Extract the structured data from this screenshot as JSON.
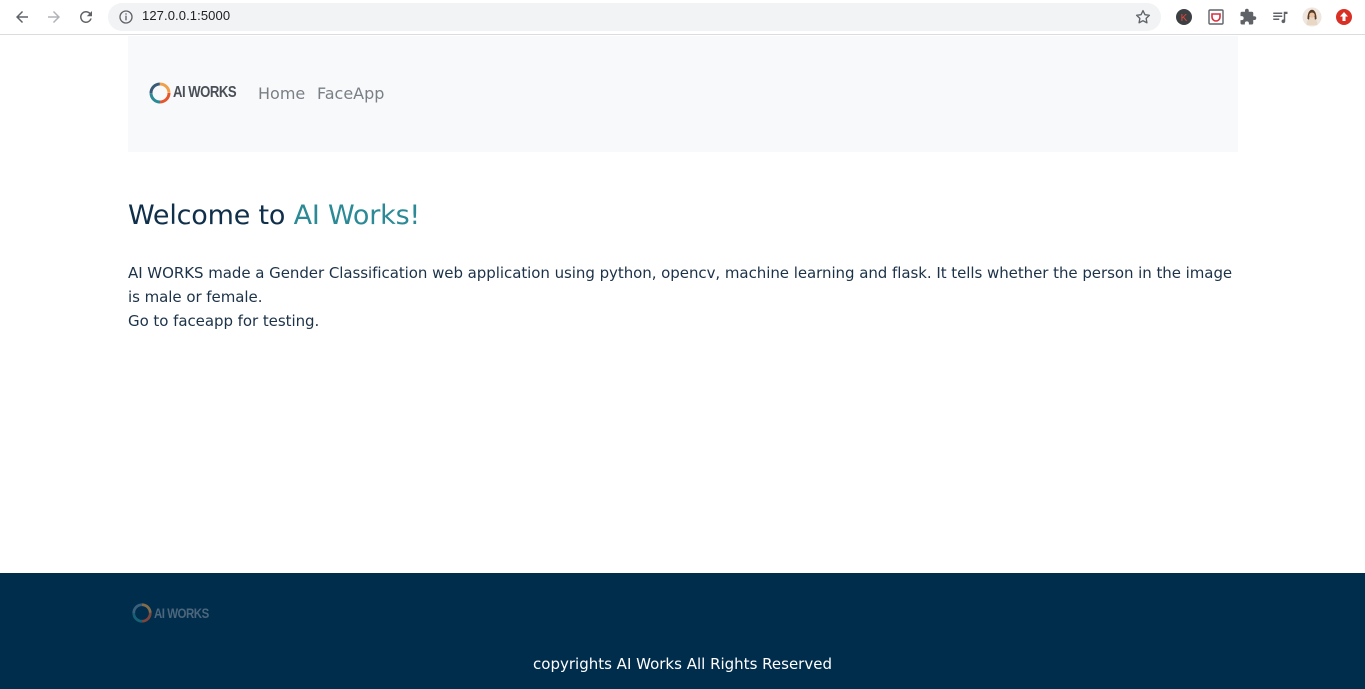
{
  "browser": {
    "url": "127.0.0.1:5000",
    "accent_color": "#1a73e8"
  },
  "navbar": {
    "brand_text": "AI WORKS",
    "links": [
      {
        "label": "Home"
      },
      {
        "label": "FaceApp"
      }
    ]
  },
  "main": {
    "heading_prefix": "Welcome to ",
    "heading_accent": "AI Works!",
    "description_line1": "AI WORKS made a Gender Classification web application using python, opencv, machine learning and flask. It tells whether the person in the image is male or female.",
    "description_line2": "Go to faceapp for testing."
  },
  "footer": {
    "brand_text": "AI WORKS",
    "copyright": "copyrights AI Works All Rights Reserved"
  },
  "colors": {
    "heading": "#0f2f4a",
    "accent": "#2b8a96",
    "footer_bg": "#002d4c",
    "navbar_bg": "#f8f9fa"
  }
}
